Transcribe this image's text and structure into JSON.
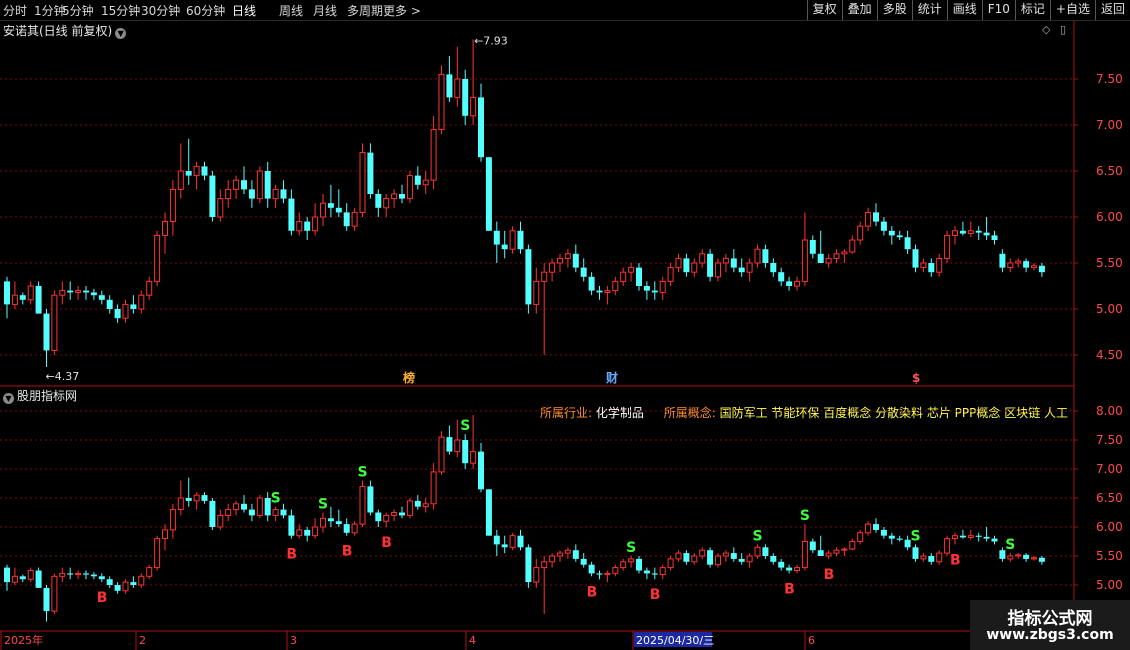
{
  "toolbar": {
    "left_items": [
      {
        "label": "分时",
        "active": false
      },
      {
        "label": "1分钟",
        "active": false
      },
      {
        "label": "5分钟",
        "active": false
      },
      {
        "label": "15分钟",
        "active": false
      },
      {
        "label": "30分钟",
        "active": false
      },
      {
        "label": "60分钟",
        "active": false
      },
      {
        "label": "日线",
        "active": true
      },
      {
        "label": "周线",
        "active": false
      },
      {
        "label": "月线",
        "active": false
      },
      {
        "label": "多周期",
        "active": false
      },
      {
        "label": "更多 >",
        "active": false
      }
    ],
    "right_items": [
      "复权",
      "叠加",
      "多股",
      "统计",
      "画线",
      "F10",
      "标记",
      "+自选",
      "返回"
    ]
  },
  "main_panel": {
    "title": "安诺其(日线 前复权)"
  },
  "indicator_panel": {
    "title": "股朋指标网"
  },
  "info_bar": {
    "industry_label": "所属行业:",
    "industry_value": "化学制品",
    "concept_label": "所属概念:",
    "concepts": "国防军工 节能环保 百度概念 分散染料 芯片 PPP概念 区块链 人工"
  },
  "colors": {
    "up": "#ff3232",
    "down": "#54ffff",
    "grid": "#7a0a0a",
    "buy": "#ff3232",
    "sell": "#3cff3c"
  },
  "chart_data": {
    "type": "candlestick",
    "price_axis": {
      "ticks": [
        4.5,
        5.0,
        5.5,
        6.0,
        6.5,
        7.0,
        7.5
      ]
    },
    "indicator_axis": {
      "ticks": [
        5.0,
        5.5,
        6.0,
        6.5,
        7.0,
        7.5,
        8.0
      ]
    },
    "max_label": "7.93",
    "min_label": "4.37",
    "time_axis": [
      "2025年",
      "2",
      "3",
      "4",
      "2025/04/30/三",
      "6"
    ],
    "event_markers": [
      "榜",
      "财",
      "$"
    ],
    "candles": [
      [
        5.3,
        5.35,
        4.9,
        5.05
      ],
      [
        5.05,
        5.3,
        5.0,
        5.15
      ],
      [
        5.15,
        5.18,
        5.05,
        5.1
      ],
      [
        5.1,
        5.3,
        5.05,
        5.25
      ],
      [
        5.25,
        5.3,
        4.95,
        4.95
      ],
      [
        4.95,
        5.0,
        4.37,
        4.55
      ],
      [
        4.55,
        5.2,
        4.5,
        5.15
      ],
      [
        5.15,
        5.3,
        5.05,
        5.2
      ],
      [
        5.2,
        5.3,
        5.1,
        5.18
      ],
      [
        5.18,
        5.25,
        5.1,
        5.2
      ],
      [
        5.2,
        5.25,
        5.1,
        5.18
      ],
      [
        5.18,
        5.22,
        5.1,
        5.15
      ],
      [
        5.15,
        5.2,
        5.05,
        5.1
      ],
      [
        5.1,
        5.15,
        4.95,
        5.0
      ],
      [
        5.0,
        5.05,
        4.85,
        4.9
      ],
      [
        4.9,
        5.1,
        4.85,
        5.05
      ],
      [
        5.05,
        5.15,
        4.95,
        5.0
      ],
      [
        5.0,
        5.2,
        4.95,
        5.15
      ],
      [
        5.15,
        5.35,
        5.1,
        5.3
      ],
      [
        5.3,
        5.85,
        5.25,
        5.8
      ],
      [
        5.8,
        6.05,
        5.6,
        5.95
      ],
      [
        5.95,
        6.4,
        5.8,
        6.3
      ],
      [
        6.3,
        6.8,
        6.2,
        6.5
      ],
      [
        6.5,
        6.85,
        6.35,
        6.45
      ],
      [
        6.45,
        6.6,
        6.3,
        6.55
      ],
      [
        6.55,
        6.6,
        6.4,
        6.45
      ],
      [
        6.45,
        6.5,
        5.95,
        6.0
      ],
      [
        6.0,
        6.3,
        5.95,
        6.2
      ],
      [
        6.2,
        6.4,
        6.1,
        6.3
      ],
      [
        6.3,
        6.45,
        6.2,
        6.4
      ],
      [
        6.4,
        6.55,
        6.25,
        6.3
      ],
      [
        6.3,
        6.4,
        6.1,
        6.2
      ],
      [
        6.2,
        6.55,
        6.15,
        6.5
      ],
      [
        6.5,
        6.6,
        6.1,
        6.2
      ],
      [
        6.2,
        6.35,
        6.1,
        6.3
      ],
      [
        6.3,
        6.4,
        6.15,
        6.2
      ],
      [
        6.2,
        6.3,
        5.8,
        5.85
      ],
      [
        5.85,
        6.05,
        5.8,
        5.95
      ],
      [
        5.95,
        6.0,
        5.75,
        5.85
      ],
      [
        5.85,
        6.15,
        5.8,
        6.0
      ],
      [
        6.0,
        6.25,
        5.9,
        6.15
      ],
      [
        6.15,
        6.35,
        6.0,
        6.1
      ],
      [
        6.1,
        6.3,
        6.0,
        6.05
      ],
      [
        6.05,
        6.15,
        5.85,
        5.9
      ],
      [
        5.9,
        6.1,
        5.85,
        6.05
      ],
      [
        6.05,
        6.8,
        6.0,
        6.7
      ],
      [
        6.7,
        6.8,
        6.2,
        6.25
      ],
      [
        6.25,
        6.3,
        6.0,
        6.1
      ],
      [
        6.1,
        6.25,
        6.0,
        6.2
      ],
      [
        6.2,
        6.3,
        6.1,
        6.25
      ],
      [
        6.25,
        6.35,
        6.15,
        6.2
      ],
      [
        6.2,
        6.5,
        6.15,
        6.45
      ],
      [
        6.45,
        6.55,
        6.3,
        6.35
      ],
      [
        6.35,
        6.5,
        6.25,
        6.4
      ],
      [
        6.4,
        7.1,
        6.3,
        6.95
      ],
      [
        6.95,
        7.65,
        6.9,
        7.55
      ],
      [
        7.55,
        7.75,
        7.25,
        7.3
      ],
      [
        7.3,
        7.85,
        7.2,
        7.5
      ],
      [
        7.5,
        7.6,
        7.0,
        7.1
      ],
      [
        7.1,
        7.93,
        7.0,
        7.3
      ],
      [
        7.3,
        7.45,
        6.6,
        6.65
      ],
      [
        6.65,
        6.65,
        5.85,
        5.85
      ],
      [
        5.85,
        5.95,
        5.5,
        5.7
      ],
      [
        5.7,
        5.85,
        5.55,
        5.65
      ],
      [
        5.65,
        5.9,
        5.6,
        5.85
      ],
      [
        5.85,
        5.95,
        5.6,
        5.65
      ],
      [
        5.65,
        5.7,
        4.95,
        5.05
      ],
      [
        5.05,
        5.45,
        4.95,
        5.3
      ],
      [
        5.3,
        5.5,
        4.5,
        5.4
      ],
      [
        5.4,
        5.55,
        5.3,
        5.5
      ],
      [
        5.5,
        5.6,
        5.4,
        5.55
      ],
      [
        5.55,
        5.65,
        5.45,
        5.6
      ],
      [
        5.6,
        5.7,
        5.4,
        5.45
      ],
      [
        5.45,
        5.55,
        5.3,
        5.35
      ],
      [
        5.35,
        5.4,
        5.15,
        5.2
      ],
      [
        5.2,
        5.25,
        5.1,
        5.18
      ],
      [
        5.18,
        5.25,
        5.05,
        5.2
      ],
      [
        5.2,
        5.35,
        5.15,
        5.3
      ],
      [
        5.3,
        5.45,
        5.25,
        5.4
      ],
      [
        5.4,
        5.5,
        5.3,
        5.45
      ],
      [
        5.45,
        5.5,
        5.2,
        5.25
      ],
      [
        5.25,
        5.3,
        5.1,
        5.2
      ],
      [
        5.2,
        5.3,
        5.1,
        5.18
      ],
      [
        5.18,
        5.35,
        5.1,
        5.3
      ],
      [
        5.3,
        5.5,
        5.25,
        5.45
      ],
      [
        5.45,
        5.6,
        5.4,
        5.55
      ],
      [
        5.55,
        5.6,
        5.35,
        5.4
      ],
      [
        5.4,
        5.55,
        5.35,
        5.5
      ],
      [
        5.5,
        5.65,
        5.45,
        5.6
      ],
      [
        5.6,
        5.65,
        5.3,
        5.35
      ],
      [
        5.35,
        5.55,
        5.3,
        5.5
      ],
      [
        5.5,
        5.6,
        5.4,
        5.55
      ],
      [
        5.55,
        5.65,
        5.4,
        5.45
      ],
      [
        5.45,
        5.55,
        5.35,
        5.4
      ],
      [
        5.4,
        5.55,
        5.3,
        5.5
      ],
      [
        5.5,
        5.7,
        5.45,
        5.65
      ],
      [
        5.65,
        5.7,
        5.45,
        5.5
      ],
      [
        5.5,
        5.55,
        5.35,
        5.4
      ],
      [
        5.4,
        5.45,
        5.25,
        5.3
      ],
      [
        5.3,
        5.35,
        5.2,
        5.25
      ],
      [
        5.25,
        5.35,
        5.2,
        5.3
      ],
      [
        5.3,
        6.05,
        5.25,
        5.75
      ],
      [
        5.75,
        5.8,
        5.55,
        5.6
      ],
      [
        5.6,
        5.85,
        5.5,
        5.5
      ],
      [
        5.5,
        5.6,
        5.45,
        5.55
      ],
      [
        5.55,
        5.65,
        5.5,
        5.6
      ],
      [
        5.6,
        5.65,
        5.5,
        5.62
      ],
      [
        5.62,
        5.8,
        5.6,
        5.75
      ],
      [
        5.75,
        5.95,
        5.7,
        5.9
      ],
      [
        5.9,
        6.1,
        5.85,
        6.05
      ],
      [
        6.05,
        6.15,
        5.9,
        5.95
      ],
      [
        5.95,
        6.0,
        5.8,
        5.85
      ],
      [
        5.85,
        5.9,
        5.7,
        5.8
      ],
      [
        5.8,
        5.85,
        5.75,
        5.78
      ],
      [
        5.78,
        5.85,
        5.6,
        5.65
      ],
      [
        5.65,
        5.7,
        5.4,
        5.45
      ],
      [
        5.45,
        5.55,
        5.4,
        5.5
      ],
      [
        5.5,
        5.55,
        5.35,
        5.4
      ],
      [
        5.4,
        5.6,
        5.35,
        5.55
      ],
      [
        5.55,
        5.85,
        5.5,
        5.8
      ],
      [
        5.8,
        5.9,
        5.7,
        5.85
      ],
      [
        5.85,
        5.95,
        5.8,
        5.82
      ],
      [
        5.82,
        5.95,
        5.78,
        5.85
      ],
      [
        5.85,
        5.9,
        5.75,
        5.83
      ],
      [
        5.83,
        6.0,
        5.75,
        5.8
      ],
      [
        5.8,
        5.85,
        5.7,
        5.75
      ],
      [
        5.6,
        5.65,
        5.4,
        5.45
      ],
      [
        5.45,
        5.55,
        5.4,
        5.5
      ],
      [
        5.5,
        5.55,
        5.45,
        5.52
      ],
      [
        5.52,
        5.55,
        5.4,
        5.45
      ],
      [
        5.45,
        5.5,
        5.42,
        5.47
      ],
      [
        5.47,
        5.5,
        5.35,
        5.4
      ]
    ],
    "signals": [
      {
        "i": 12,
        "type": "B"
      },
      {
        "i": 34,
        "type": "S"
      },
      {
        "i": 36,
        "type": "B"
      },
      {
        "i": 40,
        "type": "S"
      },
      {
        "i": 43,
        "type": "B"
      },
      {
        "i": 45,
        "type": "S"
      },
      {
        "i": 48,
        "type": "B"
      },
      {
        "i": 58,
        "type": "S"
      },
      {
        "i": 74,
        "type": "B"
      },
      {
        "i": 79,
        "type": "S"
      },
      {
        "i": 82,
        "type": "B"
      },
      {
        "i": 95,
        "type": "S"
      },
      {
        "i": 99,
        "type": "B"
      },
      {
        "i": 101,
        "type": "S"
      },
      {
        "i": 104,
        "type": "B"
      },
      {
        "i": 115,
        "type": "S"
      },
      {
        "i": 120,
        "type": "B"
      },
      {
        "i": 127,
        "type": "S"
      }
    ]
  }
}
